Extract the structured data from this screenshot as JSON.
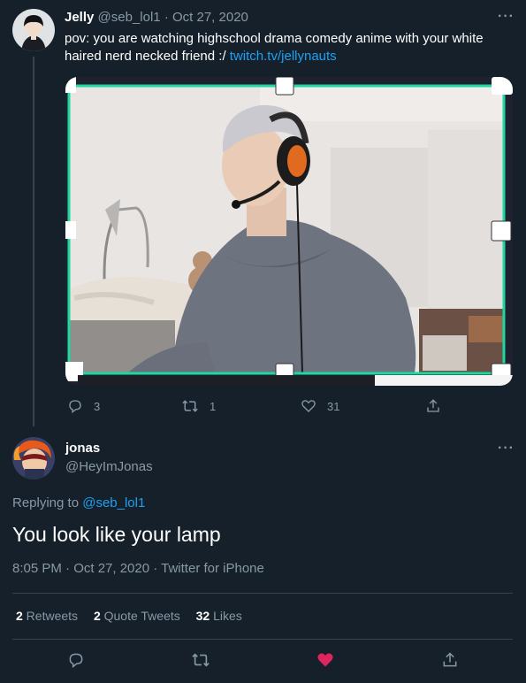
{
  "tweet": {
    "author_name": "Jelly",
    "author_handle": "@seb_lol1",
    "separator": "·",
    "date": "Oct 27, 2020",
    "text": "pov: you are watching highschool drama comedy anime with your white haired nerd necked friend :/ ",
    "link_text": "twitch.tv/jellynauts",
    "more_icon": "more-horizontal-icon",
    "actions": {
      "reply_count": "3",
      "retweet_count": "1",
      "like_count": "31"
    }
  },
  "reply": {
    "author_name": "jonas",
    "author_handle": "@HeyImJonas",
    "replying_prefix": "Replying to ",
    "replying_handle": "@seb_lol1",
    "text": "You look like your lamp",
    "meta": "8:05 PM · Oct 27, 2020 · Twitter for iPhone",
    "stats": {
      "retweets_count": "2",
      "retweets_label": " Retweets",
      "quotes_count": "2",
      "quotes_label": " Quote Tweets",
      "likes_count": "32",
      "likes_label": " Likes"
    }
  },
  "colors": {
    "background": "#15202b",
    "muted": "#8899a6",
    "link": "#1da1f2",
    "like_active": "#e0245e",
    "divider": "#38444d",
    "selection_outline": "#1ed8a0"
  }
}
